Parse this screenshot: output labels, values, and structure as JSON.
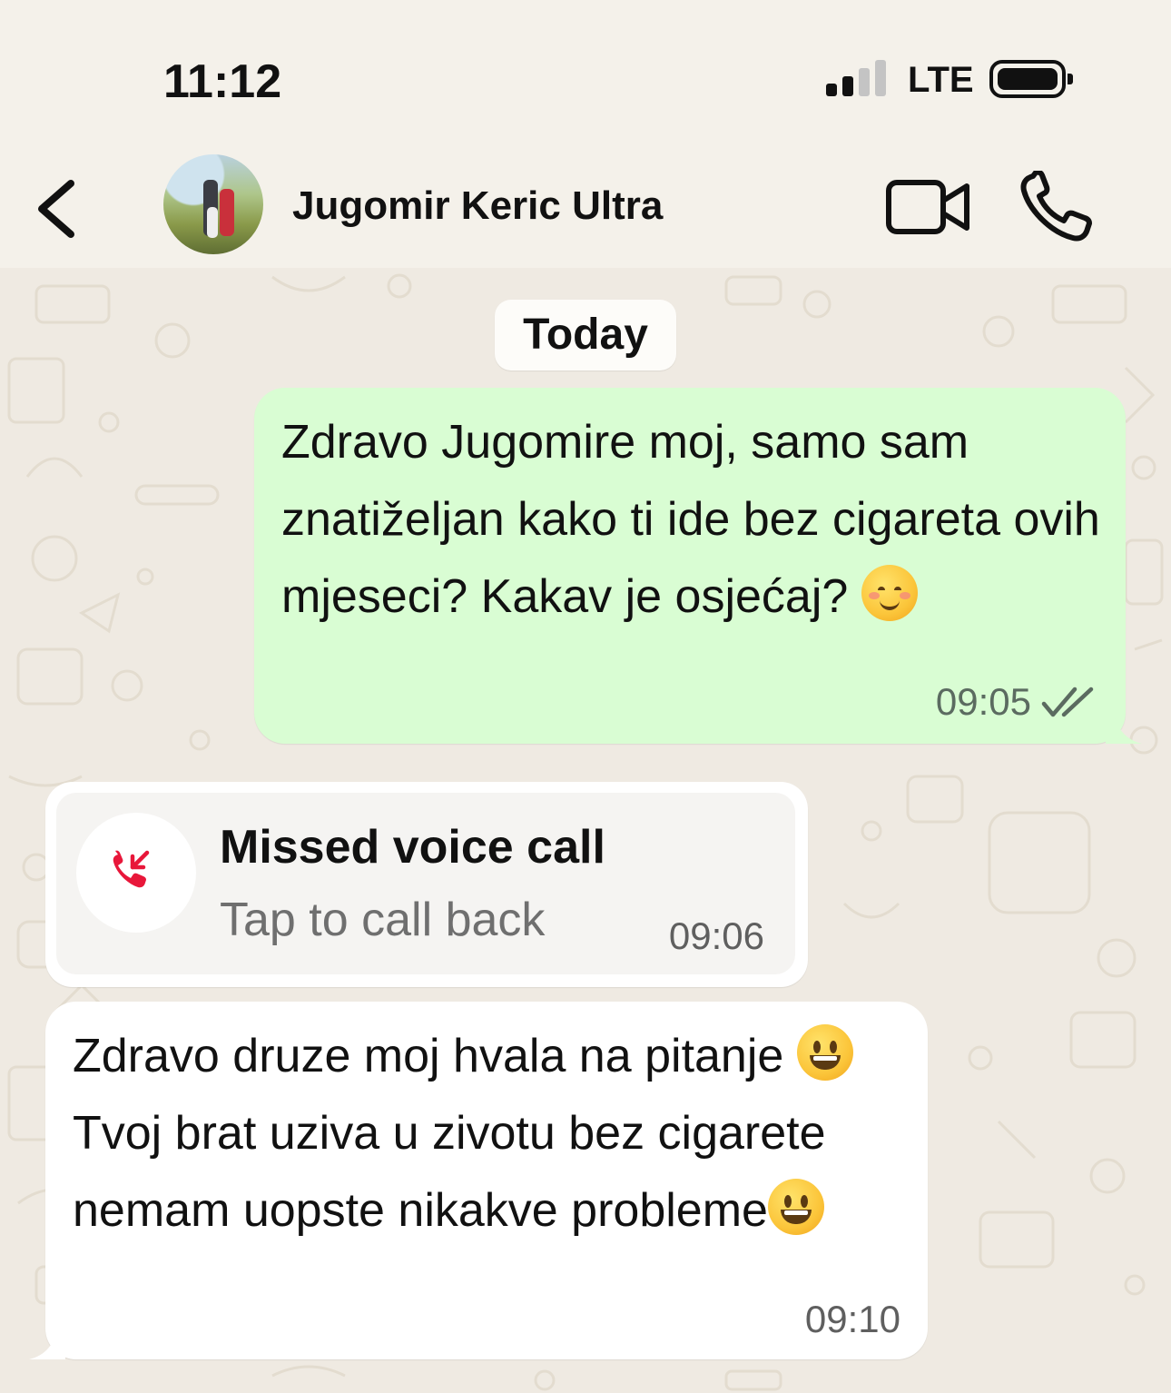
{
  "status_bar": {
    "time": "11:12",
    "network": "LTE"
  },
  "header": {
    "contact_name": "Jugomir Keric Ultra"
  },
  "chat": {
    "date_label": "Today",
    "messages": [
      {
        "direction": "outgoing",
        "text": "Zdravo Jugomire moj, samo sam znatiželjan kako ti ide bez cigareta ovih mjeseci? Kakav je osjećaj? ",
        "time": "09:05",
        "status": "read-double-check"
      },
      {
        "direction": "incoming",
        "type": "missed-call",
        "title": "Missed voice call",
        "subtitle": "Tap to call back",
        "time": "09:06"
      },
      {
        "direction": "incoming",
        "text_part1": "Zdravo druze moj hvala na pitanje ",
        "text_part2": "Tvoj brat uziva u zivotu bez cigarete nemam uopste nikakve probleme",
        "time": "09:10"
      }
    ]
  },
  "colors": {
    "outgoing_bubble": "#d9fdd3",
    "incoming_bubble": "#ffffff",
    "chat_background": "#efeae2",
    "missed_call_red": "#e8173a"
  },
  "icons": [
    "back-chevron-icon",
    "video-call-icon",
    "voice-call-icon",
    "double-check-icon",
    "missed-call-icon",
    "signal-icon",
    "battery-icon"
  ]
}
